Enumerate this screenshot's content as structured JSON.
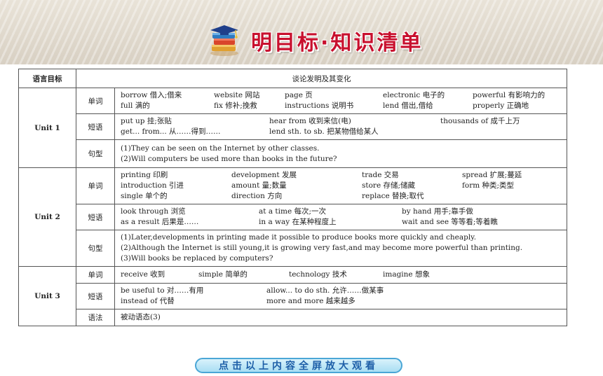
{
  "title": "明目标·知识清单",
  "header": {
    "col1": "语言目标",
    "col2": "谈论发明及其变化"
  },
  "units": [
    {
      "name": "Unit 1",
      "rows": [
        {
          "cat": "单词",
          "layout": "g5",
          "items": [
            "borrow 借入;借来",
            "website 网站",
            "page 页",
            "electronic 电子的",
            "powerful 有影响力的",
            "full 满的",
            "fix 修补;挽救",
            "instructions 说明书",
            "lend 借出,借给",
            "properly 正确地"
          ]
        },
        {
          "cat": "短语",
          "layout": "g3a",
          "items": [
            "put up 挂;张贴",
            "hear from 收到来信(电)",
            "thousands of 成千上万",
            "get... from... 从……得到……",
            "lend sth. to sb. 把某物借给某人",
            ""
          ]
        },
        {
          "cat": "句型",
          "layout": "lines",
          "items": [
            "(1)They can be seen on the Internet by other classes.",
            "(2)Will computers be used more than books in the future?"
          ]
        }
      ]
    },
    {
      "name": "Unit 2",
      "rows": [
        {
          "cat": "单词",
          "layout": "g4",
          "items": [
            "printing 印刷",
            "development 发展",
            "trade 交易",
            "spread 扩展;蔓延",
            "introduction 引进",
            "amount 量;数量",
            "store 存储;储藏",
            "form 种类;类型",
            "single 单个的",
            "direction 方向",
            "replace 替换;取代",
            ""
          ]
        },
        {
          "cat": "短语",
          "layout": "g3b",
          "items": [
            "look through 浏览",
            "at a time 每次;一次",
            "by hand 用手;靠手做",
            "as a result 后果是……",
            "in a way 在某种程度上",
            "wait and see 等等看;等着瞧"
          ]
        },
        {
          "cat": "句型",
          "layout": "lines",
          "items": [
            "(1)Later,developments in printing made it possible to produce books more quickly and cheaply.",
            "(2)Although the Internet is still young,it is growing very fast,and may become more powerful than printing.",
            "(3)Will books be replaced by computers?"
          ]
        }
      ]
    },
    {
      "name": "Unit 3",
      "rows": [
        {
          "cat": "单词",
          "layout": "g4b",
          "items": [
            "receive 收到",
            "simple 简单的",
            "technology 技术",
            "imagine 想象"
          ]
        },
        {
          "cat": "短语",
          "layout": "g2",
          "items": [
            "be useful to 对……有用",
            "allow... to do sth. 允许……做某事",
            "instead of 代替",
            "more and more 越来越多"
          ]
        },
        {
          "cat": "语法",
          "layout": "lines",
          "items": [
            "被动语态(3)"
          ]
        }
      ]
    }
  ],
  "bottom_button": "点击以上内容全屏放大观看",
  "colors": {
    "title": "#c8102e",
    "button_text": "#1e5fa8",
    "button_border": "#4aa6d6"
  }
}
